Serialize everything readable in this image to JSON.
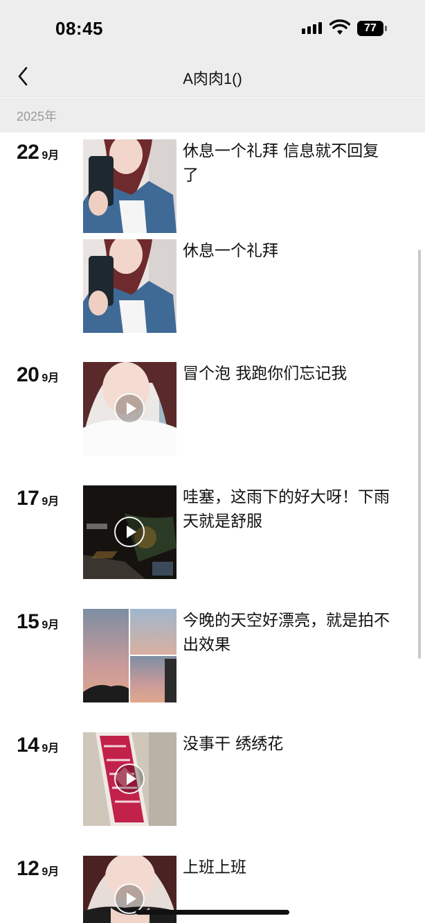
{
  "status": {
    "time": "08:45",
    "battery": "77"
  },
  "nav": {
    "title": "A肉肉1()"
  },
  "year": "2025年",
  "posts": [
    {
      "day": "22",
      "month": "9月",
      "caption": "休息一个礼拜 信息就不回复了",
      "thumb": "selfie-mirror",
      "video": false
    },
    {
      "day": "",
      "month": "",
      "caption": "休息一个礼拜",
      "thumb": "selfie-mirror",
      "video": false
    },
    {
      "day": "20",
      "month": "9月",
      "caption": "冒个泡 我跑你们忘记我",
      "thumb": "selfie-face",
      "video": true
    },
    {
      "day": "17",
      "month": "9月",
      "caption": "哇塞，这雨下的好大呀！下雨天就是舒服",
      "thumb": "night-rain",
      "video": true
    },
    {
      "day": "15",
      "month": "9月",
      "caption": "今晚的天空好漂亮，就是拍不出效果",
      "thumb": "sunset-grid",
      "video": false
    },
    {
      "day": "14",
      "month": "9月",
      "caption": "没事干 绣绣花",
      "thumb": "embroidery",
      "video": true
    },
    {
      "day": "12",
      "month": "9月",
      "caption": "上班上班",
      "thumb": "selfie-face",
      "video": true
    }
  ],
  "colors": {
    "background": "#ffffff",
    "header": "#ededed",
    "text": "#111111",
    "muted": "#9a9a9a"
  },
  "icons": [
    "back-chevron-icon",
    "signal-icon",
    "wifi-icon",
    "battery-icon",
    "play-icon"
  ]
}
